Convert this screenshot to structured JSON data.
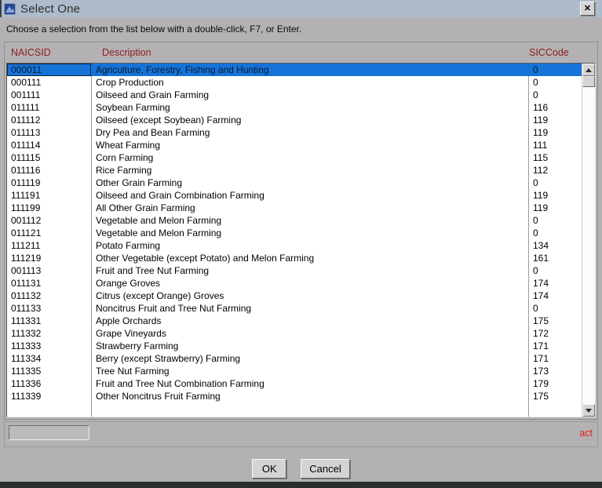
{
  "window": {
    "title": "Select One",
    "close_glyph": "✕"
  },
  "instruction": "Choose a selection from the list below with a double-click, F7, or Enter.",
  "table": {
    "columns": {
      "naicsid": "NAICSID",
      "description": "Description",
      "siccode": "SICCode"
    },
    "selected_index": 0,
    "rows": [
      {
        "naicsid": "000011",
        "description": "Agriculture, Forestry, Fishing and Hunting",
        "siccode": "0"
      },
      {
        "naicsid": "000111",
        "description": "Crop Production",
        "siccode": "0"
      },
      {
        "naicsid": "001111",
        "description": "Oilseed and Grain Farming",
        "siccode": "0"
      },
      {
        "naicsid": "011111",
        "description": "Soybean Farming",
        "siccode": "116"
      },
      {
        "naicsid": "011112",
        "description": "Oilseed (except Soybean) Farming",
        "siccode": "119"
      },
      {
        "naicsid": "011113",
        "description": "Dry Pea and Bean Farming",
        "siccode": "119"
      },
      {
        "naicsid": "011114",
        "description": "Wheat Farming",
        "siccode": "111"
      },
      {
        "naicsid": "011115",
        "description": "Corn Farming",
        "siccode": "115"
      },
      {
        "naicsid": "011116",
        "description": "Rice Farming",
        "siccode": "112"
      },
      {
        "naicsid": "011119",
        "description": "Other Grain Farming",
        "siccode": "0"
      },
      {
        "naicsid": "111191",
        "description": "Oilseed and Grain Combination Farming",
        "siccode": "119"
      },
      {
        "naicsid": "111199",
        "description": "All Other Grain Farming",
        "siccode": "119"
      },
      {
        "naicsid": "001112",
        "description": "Vegetable and Melon Farming",
        "siccode": "0"
      },
      {
        "naicsid": "011121",
        "description": "Vegetable and Melon Farming",
        "siccode": "0"
      },
      {
        "naicsid": "111211",
        "description": "Potato Farming",
        "siccode": "134"
      },
      {
        "naicsid": "111219",
        "description": "Other Vegetable (except Potato) and Melon Farming",
        "siccode": "161"
      },
      {
        "naicsid": "001113",
        "description": "Fruit and Tree Nut Farming",
        "siccode": "0"
      },
      {
        "naicsid": "011131",
        "description": "Orange Groves",
        "siccode": "174"
      },
      {
        "naicsid": "011132",
        "description": "Citrus (except Orange) Groves",
        "siccode": "174"
      },
      {
        "naicsid": "011133",
        "description": "Noncitrus Fruit and Tree Nut Farming",
        "siccode": "0"
      },
      {
        "naicsid": "111331",
        "description": "Apple Orchards",
        "siccode": "175"
      },
      {
        "naicsid": "111332",
        "description": "Grape Vineyards",
        "siccode": "172"
      },
      {
        "naicsid": "111333",
        "description": "Strawberry Farming",
        "siccode": "171"
      },
      {
        "naicsid": "111334",
        "description": "Berry (except Strawberry) Farming",
        "siccode": "171"
      },
      {
        "naicsid": "111335",
        "description": "Tree Nut Farming",
        "siccode": "173"
      },
      {
        "naicsid": "111336",
        "description": "Fruit and Tree Nut Combination Farming",
        "siccode": "179"
      },
      {
        "naicsid": "111339",
        "description": "Other Noncitrus Fruit Farming",
        "siccode": "175"
      }
    ]
  },
  "footer": {
    "filter_value": "",
    "status_text": "act"
  },
  "actions": {
    "ok": "OK",
    "cancel": "Cancel"
  },
  "colors": {
    "titlebar_bg": "#aebbca",
    "dialog_bg": "#b4b1b4",
    "header_text": "#8b1f1f",
    "selection_bg": "#1673d8",
    "status_color": "#e62222"
  }
}
